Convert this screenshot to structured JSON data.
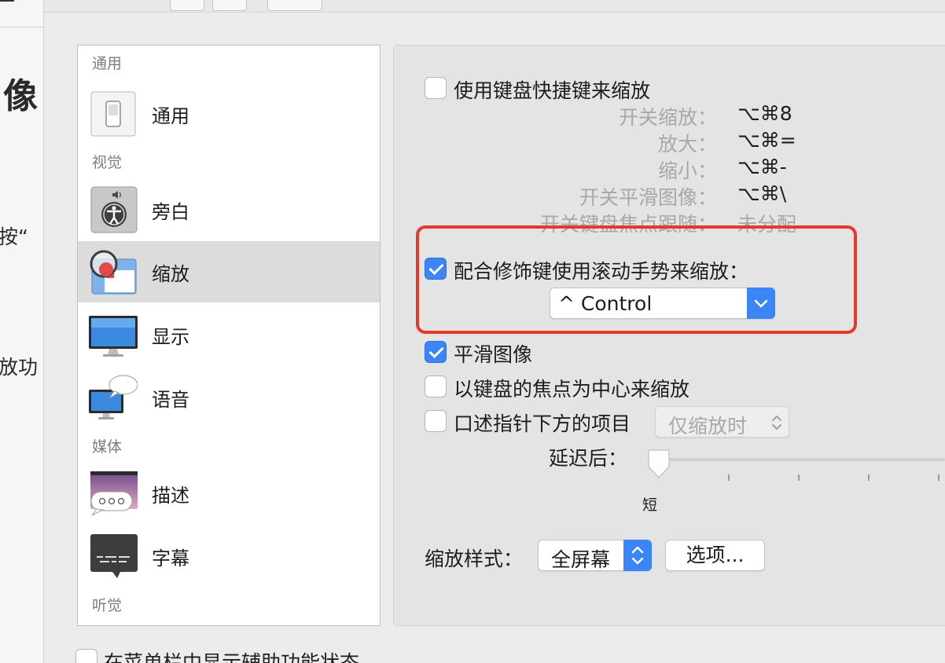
{
  "background_window": {
    "title_fragment": "像",
    "text_1": "按“",
    "text_2": "放功"
  },
  "sidebar": {
    "sections": [
      {
        "label": "通用"
      },
      {
        "label": "视觉"
      },
      {
        "label": "媒体"
      },
      {
        "label": "听觉"
      }
    ],
    "items": [
      {
        "label": "通用",
        "icon": "switch-icon"
      },
      {
        "label": "旁白",
        "icon": "voiceover-icon"
      },
      {
        "label": "缩放",
        "icon": "zoom-icon",
        "selected": true
      },
      {
        "label": "显示",
        "icon": "display-icon"
      },
      {
        "label": "语音",
        "icon": "speech-icon"
      },
      {
        "label": "描述",
        "icon": "descriptions-icon"
      },
      {
        "label": "字幕",
        "icon": "captions-icon"
      }
    ]
  },
  "zoom": {
    "keyboard_shortcuts": {
      "label": "使用键盘快捷键来缩放",
      "checked": false,
      "shortcuts": [
        {
          "name": "开关缩放：",
          "keys": "⌥⌘8"
        },
        {
          "name": "放大：",
          "keys": "⌥⌘="
        },
        {
          "name": "缩小：",
          "keys": "⌥⌘-"
        },
        {
          "name": "开关平滑图像：",
          "keys": "⌥⌘\\"
        },
        {
          "name": "开关键盘焦点跟随：",
          "keys": "未分配"
        }
      ]
    },
    "scroll_gesture": {
      "label": "配合修饰键使用滚动手势来缩放：",
      "checked": true,
      "modifier_value": "^ Control"
    },
    "smooth_images": {
      "label": "平滑图像",
      "checked": true
    },
    "follow_focus": {
      "label": "以键盘的焦点为中心来缩放",
      "checked": false
    },
    "speak_items": {
      "label": "口述指针下方的项目",
      "checked": false,
      "mode_value": "仅缩放时"
    },
    "delay": {
      "label": "延迟后：",
      "min_label": "短",
      "level": 0
    },
    "zoom_style": {
      "label": "缩放样式：",
      "value": "全屏幕",
      "options_button": "选项..."
    }
  },
  "footer": {
    "menu_bar_status": {
      "label": "在菜单栏中显示辅助功能状态",
      "checked": false
    }
  },
  "colors": {
    "accent": "#3b85f6",
    "highlight_border": "#e5392b",
    "selected_row": "#dcdcdc"
  }
}
